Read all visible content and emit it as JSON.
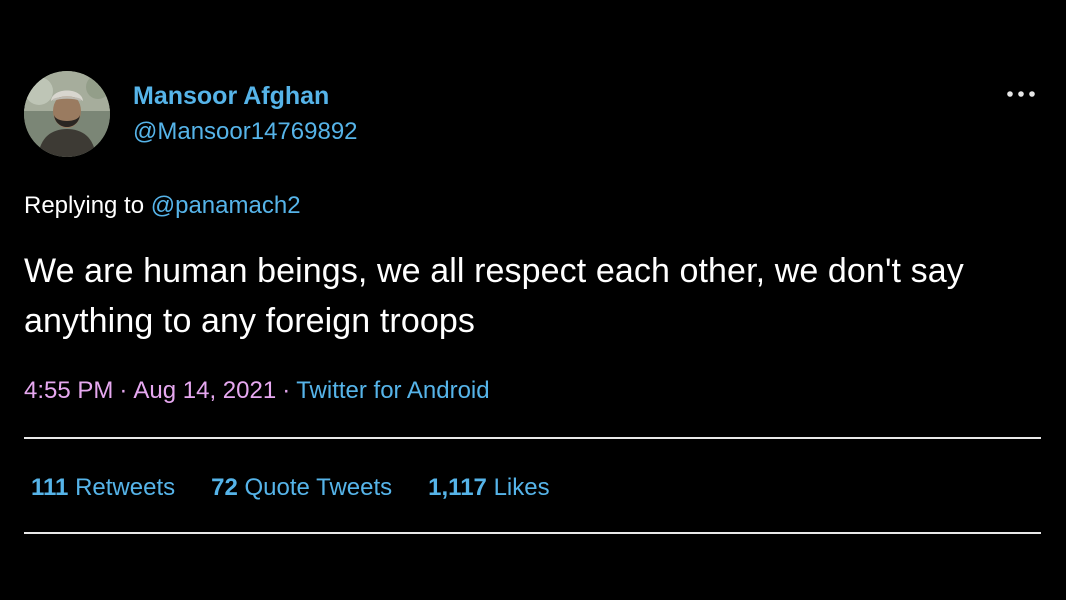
{
  "colors": {
    "background": "#000000",
    "text": "#ffffff",
    "link": "#56b4e9",
    "meta": "#e6a8f0",
    "divider": "#e8e8e8"
  },
  "author": {
    "display_name": "Mansoor Afghan",
    "handle": "@Mansoor14769892",
    "avatar_icon": "profile-photo"
  },
  "more_icon": "more-horizontal-icon",
  "reply": {
    "prefix": "Replying to",
    "mention": "@panamach2"
  },
  "tweet": {
    "text": "We are human beings, we all respect each other, we don't say anything to any foreign troops"
  },
  "meta": {
    "time": "4:55 PM",
    "separator": "·",
    "date": "Aug 14, 2021",
    "source": "Twitter for Android"
  },
  "stats": {
    "retweets_count": "111",
    "retweets_label": "Retweets",
    "quotes_count": "72",
    "quotes_label": "Quote Tweets",
    "likes_count": "1,117",
    "likes_label": "Likes"
  }
}
